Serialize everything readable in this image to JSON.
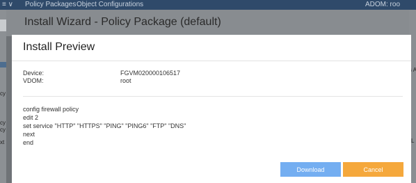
{
  "topbar": {
    "menu_icon": "chevron-down-icon",
    "menu_glyph": "≡ ∨",
    "tab_policy_packages": "Policy Packages",
    "tab_object_configurations": "Object Configurations",
    "adom": "ADOM: roo"
  },
  "background": {
    "left_snippets": [
      "cy",
      "cy",
      "cy",
      "xt"
    ],
    "right_snippets": [
      "s A",
      "L"
    ]
  },
  "wizard": {
    "title": "Install Wizard - Policy Package (default)"
  },
  "dialog": {
    "title": "Install Preview",
    "device_label": "Device:",
    "device_value": "FGVM020000106517",
    "vdom_label": "VDOM:",
    "vdom_value": "root",
    "cli_lines": [
      "config firewall policy",
      "edit 2",
      "set service \"HTTP\" \"HTTPS\" \"PING\" \"PING6\" \"FTP\" \"DNS\"",
      "next",
      "end"
    ],
    "download_label": "Download",
    "cancel_label": "Cancel"
  },
  "colors": {
    "download": "#74aef1",
    "cancel": "#f5a83c",
    "topbar": "#2f4a6a"
  }
}
